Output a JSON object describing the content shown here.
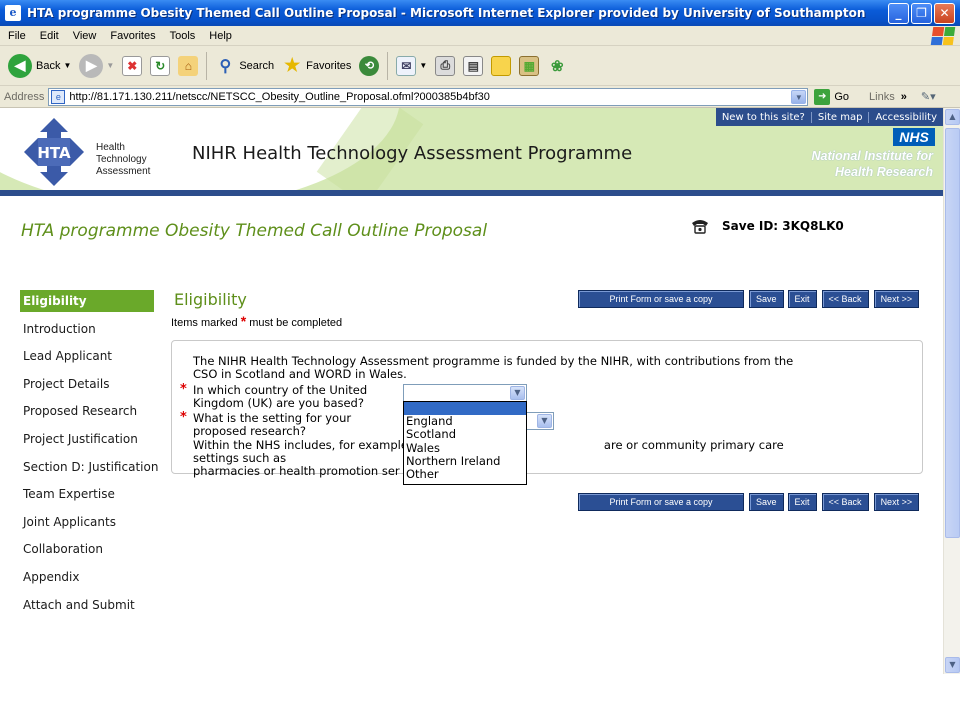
{
  "window": {
    "title": "HTA programme Obesity Themed Call Outline Proposal - Microsoft Internet Explorer provided by University of Southampton",
    "minimize": "_",
    "maximize": "❐",
    "close": "✕"
  },
  "menu": [
    "File",
    "Edit",
    "View",
    "Favorites",
    "Tools",
    "Help"
  ],
  "toolbar": {
    "back_label": "Back",
    "search_label": "Search",
    "favorites_label": "Favorites"
  },
  "address": {
    "label": "Address",
    "url": "http://81.171.130.211/netscc/NETSCC_Obesity_Outline_Proposal.ofml?000385b4bf30",
    "go_label": "Go",
    "links_label": "Links"
  },
  "header": {
    "top_links": [
      "New to this site?",
      "Site map",
      "Accessibility"
    ],
    "logo_abbr": "HTA",
    "logo_text": [
      "Health",
      "Technology",
      "Assessment"
    ],
    "site_title": "NIHR Health Technology Assessment Programme",
    "nhs": "NHS",
    "nihr_lines": [
      "National Institute for",
      "Health Research"
    ]
  },
  "proposal_title": "HTA programme Obesity Themed Call Outline Proposal",
  "save_id": "Save ID: 3KQ8LK0",
  "nav": [
    "Eligibility",
    "Introduction",
    "Lead Applicant",
    "Project Details",
    "Proposed Research",
    "Project Justification",
    "Section D: Justification",
    "Team Expertise",
    "Joint Applicants",
    "Collaboration",
    "Appendix",
    "Attach and Submit"
  ],
  "section_title": "Eligibility",
  "required_note": {
    "before": "Items marked",
    "star": "*",
    "after": "must be completed"
  },
  "buttons": {
    "print": "Print Form or save a copy",
    "save": "Save",
    "exit": "Exit",
    "back": "<< Back",
    "next": "Next >>"
  },
  "form": {
    "intro_line1": "The NIHR Health Technology Assessment programme is funded by the NIHR, with contributions from the",
    "intro_line2": "CSO in Scotland and WORD in Wales.",
    "q1_line1": "In which country of the United",
    "q1_line2": "Kingdom (UK) are you based?",
    "q2_line1": "What is the setting for your",
    "q2_line2": "proposed research?",
    "note_line1_a": "Within the NHS includes, for example",
    "note_line1_b": "are or community primary care settings such as",
    "note_line2": "pharmacies or health promotion ser",
    "country_value": "",
    "setting_value": ""
  },
  "dropdown_options": [
    "",
    "England",
    "Scotland",
    "Wales",
    "Northern Ireland",
    "Other"
  ],
  "colors": {
    "accent_green": "#6aa92a",
    "title_green": "#5e8f1a",
    "nav_blue": "#2b4f94",
    "header_green": "#d6e9b6",
    "required_red": "#dd0000"
  }
}
